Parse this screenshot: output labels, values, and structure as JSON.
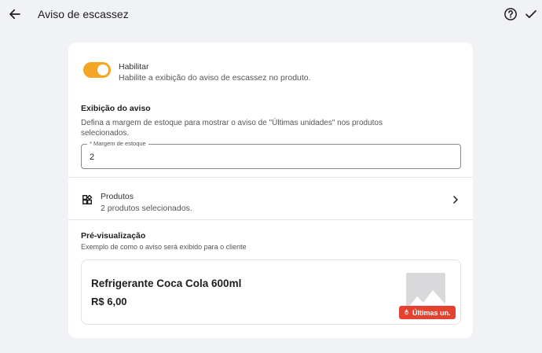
{
  "header": {
    "title": "Aviso de escassez",
    "back_icon": "arrow-left-icon",
    "help_icon": "help-circle-icon",
    "confirm_icon": "check-icon"
  },
  "enable": {
    "label": "Habilitar",
    "description": "Habilite a exibição do aviso de escassez no produto.",
    "enabled": true
  },
  "display": {
    "title": "Exibição do aviso",
    "description_line1": "Defina a margem de estoque para mostrar o aviso de \"Últimas unidades\" nos produtos",
    "description_line2": "selecionados.",
    "field_label": "* Margem de estoque",
    "field_value": "2"
  },
  "products": {
    "label": "Produtos",
    "subtitle": "2 produtos selecionados."
  },
  "preview": {
    "title": "Pré-visualização",
    "description": "Exemplo de como o aviso será exibido para o cliente",
    "product_name": "Refrigerante Coca Cola 600ml",
    "price": "R$ 6,00",
    "badge": "Últimas un."
  },
  "colors": {
    "accent": "#f5a524",
    "badge": "#e5412f",
    "background": "#f1f2f5"
  }
}
